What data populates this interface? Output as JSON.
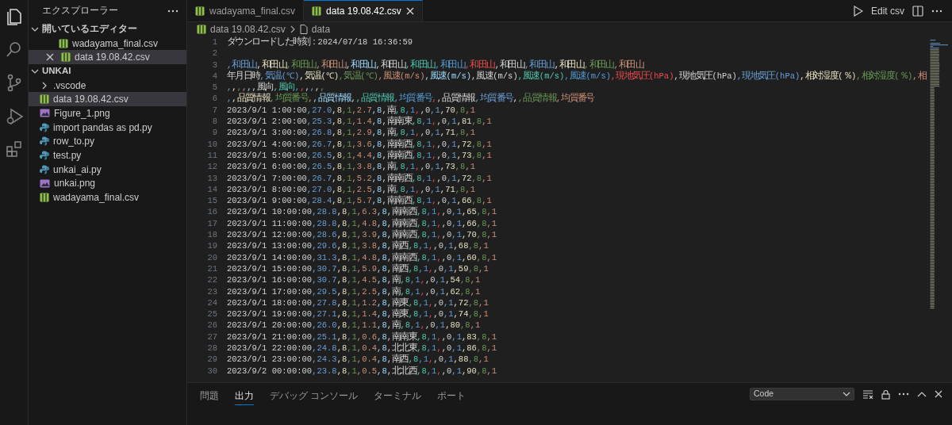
{
  "activity_bar": [
    {
      "kind": "explorer",
      "selected": true
    },
    {
      "kind": "search",
      "selected": false
    },
    {
      "kind": "source-control",
      "selected": false
    },
    {
      "kind": "run-debug",
      "selected": false
    },
    {
      "kind": "extensions",
      "selected": false
    }
  ],
  "sidebar": {
    "title": "エクスプローラー",
    "sections": [
      {
        "title": "開いているエディター",
        "expanded": true,
        "items": [
          {
            "name": "wadayama_final.csv",
            "kind": "csv",
            "selected": false,
            "show_close": false
          },
          {
            "name": "data 19.08.42.csv",
            "kind": "csv",
            "selected": true,
            "show_close": true
          }
        ]
      },
      {
        "title": "UNKAI",
        "expanded": true,
        "items": [
          {
            "name": ".vscode",
            "kind": "folder",
            "expanded": false,
            "selected": false
          },
          {
            "name": "data 19.08.42.csv",
            "kind": "csv",
            "selected": true
          },
          {
            "name": "Figure_1.png",
            "kind": "image",
            "selected": false
          },
          {
            "name": "import pandas as pd.py",
            "kind": "script",
            "selected": false
          },
          {
            "name": "row_to.py",
            "kind": "script",
            "selected": false
          },
          {
            "name": "test.py",
            "kind": "script",
            "selected": false
          },
          {
            "name": "unkai_ai.py",
            "kind": "script",
            "selected": false
          },
          {
            "name": "unkai.png",
            "kind": "image",
            "selected": false
          },
          {
            "name": "wadayama_final.csv",
            "kind": "csv",
            "selected": false
          }
        ]
      }
    ]
  },
  "tabs": [
    {
      "label": "wadayama_final.csv",
      "selected": false
    },
    {
      "label": "data 19.08.42.csv",
      "selected": true
    }
  ],
  "editor_actions": {
    "edit_label": "Edit csv"
  },
  "breadcrumb": [
    "data 19.08.42.csv",
    "data"
  ],
  "lines": [
    {
      "number": "1",
      "text": "ダウンロードした時刻：2024/07/18 16:36:59"
    },
    {
      "number": "2"
    },
    {
      "number": "3",
      "text": ",和田山,和田山,和田山,和田山,和田山,和田山,和田山,和田山,和田山,和田山,和田山,和田山,和田山,和田山"
    },
    {
      "number": "4",
      "text": "年月日時,気温(℃),気温(℃),気温(℃),風速(m/s),風速(m/s),風速(m/s),風速(m/s),風速(m/s),現地気圧(hPa),現地気圧(hPa),現地気圧(hPa),相対湿度(％),相対湿度(％),相"
    },
    {
      "number": "5",
      "text": ",,,,,,風向,風向,,,,,,"
    },
    {
      "number": "6",
      "text": ",,品質情報,均質番号,,品質情報,,品質情報,均質番号,,品質情報,均質番号,,品質情報,均質番号"
    },
    {
      "number": "7",
      "text": "2023/9/1 1:00:00,27.0,8,1,2.7,8,南,8,1,,0,1,70,8,1"
    },
    {
      "number": "8",
      "text": "2023/9/1 2:00:00,25.3,8,1,1.4,8,南南東,8,1,,0,1,81,8,1"
    },
    {
      "number": "9",
      "text": "2023/9/1 3:00:00,26.8,8,1,2.9,8,南,8,1,,0,1,71,8,1"
    },
    {
      "number": "10",
      "text": "2023/9/1 4:00:00,26.7,8,1,3.6,8,南南西,8,1,,0,1,72,8,1"
    },
    {
      "number": "11",
      "text": "2023/9/1 5:00:00,26.5,8,1,4.4,8,南南西,8,1,,0,1,73,8,1"
    },
    {
      "number": "12",
      "text": "2023/9/1 6:00:00,26.5,8,1,3.8,8,南,8,1,,0,1,73,8,1"
    },
    {
      "number": "13",
      "text": "2023/9/1 7:00:00,26.7,8,1,5.2,8,南南西,8,1,,0,1,72,8,1"
    },
    {
      "number": "14",
      "text": "2023/9/1 8:00:00,27.0,8,1,2.5,8,南,8,1,,0,1,71,8,1"
    },
    {
      "number": "15",
      "text": "2023/9/1 9:00:00,28.4,8,1,5.7,8,南南西,8,1,,0,1,66,8,1"
    },
    {
      "number": "16",
      "text": "2023/9/1 10:00:00,28.8,8,1,6.3,8,南南西,8,1,,0,1,65,8,1"
    },
    {
      "number": "17",
      "text": "2023/9/1 11:00:00,28.8,8,1,4.8,8,南南西,8,1,,0,1,66,8,1"
    },
    {
      "number": "18",
      "text": "2023/9/1 12:00:00,28.6,8,1,3.9,8,南南西,8,1,,0,1,70,8,1"
    },
    {
      "number": "19",
      "text": "2023/9/1 13:00:00,29.6,8,1,3.8,8,南西,8,1,,0,1,68,8,1"
    },
    {
      "number": "20",
      "text": "2023/9/1 14:00:00,31.3,8,1,4.8,8,南南西,8,1,,0,1,60,8,1"
    },
    {
      "number": "21",
      "text": "2023/9/1 15:00:00,30.7,8,1,5.9,8,南西,8,1,,0,1,59,8,1"
    },
    {
      "number": "22",
      "text": "2023/9/1 16:00:00,30.7,8,1,4.5,8,南,8,1,,0,1,54,8,1"
    },
    {
      "number": "23",
      "text": "2023/9/1 17:00:00,29.5,8,1,2.5,8,南,8,1,,0,1,62,8,1"
    },
    {
      "number": "24",
      "text": "2023/9/1 18:00:00,27.8,8,1,1.2,8,南東,8,1,,0,1,72,8,1"
    },
    {
      "number": "25",
      "text": "2023/9/1 19:00:00,27.1,8,1,1.4,8,南東,8,1,,0,1,74,8,1"
    },
    {
      "number": "26",
      "text": "2023/9/1 20:00:00,26.0,8,1,1.1,8,南,8,1,,0,1,80,8,1"
    },
    {
      "number": "27",
      "text": "2023/9/1 21:00:00,25.1,8,1,0.6,8,南南東,8,1,,0,1,83,8,1"
    },
    {
      "number": "28",
      "text": "2023/9/1 22:00:00,24.8,8,1,0.4,8,北北東,8,1,,0,1,86,8,1"
    },
    {
      "number": "29",
      "text": "2023/9/1 23:00:00,24.3,8,1,0.4,8,南西,8,1,,0,1,88,8,1"
    },
    {
      "number": "30",
      "text": "2023/9/2 00:00:00,23.8,8,1,0.5,8,北北西,8,1,,0,1,90,8,1"
    }
  ],
  "panel": {
    "tabs": [
      {
        "label": "問題",
        "selected": false
      },
      {
        "label": "出力",
        "selected": true
      },
      {
        "label": "デバッグ コンソール",
        "selected": false
      },
      {
        "label": "ターミナル",
        "selected": false
      },
      {
        "label": "ポート",
        "selected": false
      }
    ],
    "output_channel": "Code"
  }
}
